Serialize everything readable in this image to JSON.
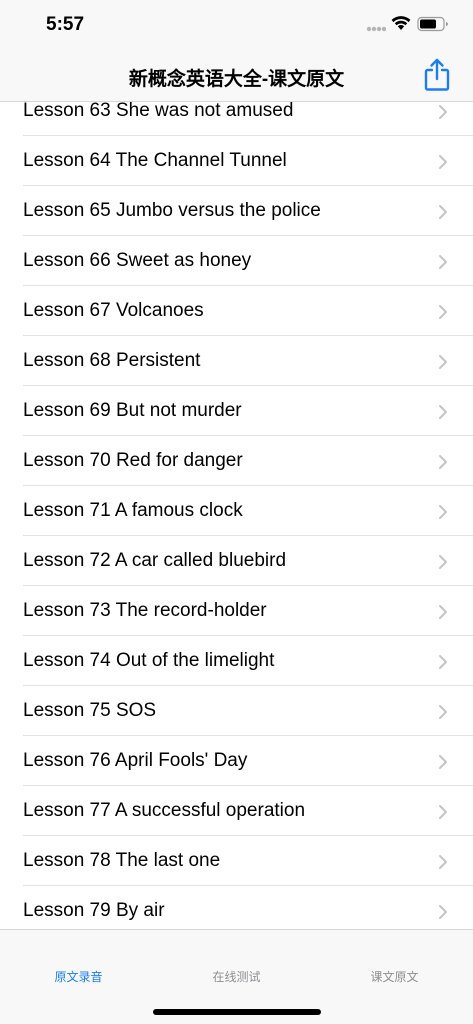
{
  "status_bar": {
    "time": "5:57"
  },
  "nav": {
    "title": "新概念英语大全-课文原文",
    "share_icon": "share-icon",
    "accent_color": "#1a7ef0"
  },
  "lessons": [
    {
      "label": "Lesson 63 She was not amused"
    },
    {
      "label": "Lesson 64 The Channel Tunnel"
    },
    {
      "label": "Lesson 65 Jumbo versus the police"
    },
    {
      "label": "Lesson 66 Sweet as honey"
    },
    {
      "label": "Lesson 67 Volcanoes"
    },
    {
      "label": "Lesson 68 Persistent"
    },
    {
      "label": "Lesson 69 But not murder"
    },
    {
      "label": "Lesson 70 Red for danger"
    },
    {
      "label": "Lesson 71 A famous clock"
    },
    {
      "label": "Lesson 72 A car called bluebird"
    },
    {
      "label": "Lesson 73 The record-holder"
    },
    {
      "label": "Lesson 74 Out of the limelight"
    },
    {
      "label": "Lesson 75 SOS"
    },
    {
      "label": "Lesson 76 April Fools' Day"
    },
    {
      "label": "Lesson 77 A successful operation"
    },
    {
      "label": "Lesson 78 The last one"
    },
    {
      "label": "Lesson 79 By air"
    }
  ],
  "tabs": [
    {
      "label": "原文录音",
      "active": true
    },
    {
      "label": "在线测试",
      "active": false
    },
    {
      "label": "课文原文",
      "active": false
    }
  ]
}
